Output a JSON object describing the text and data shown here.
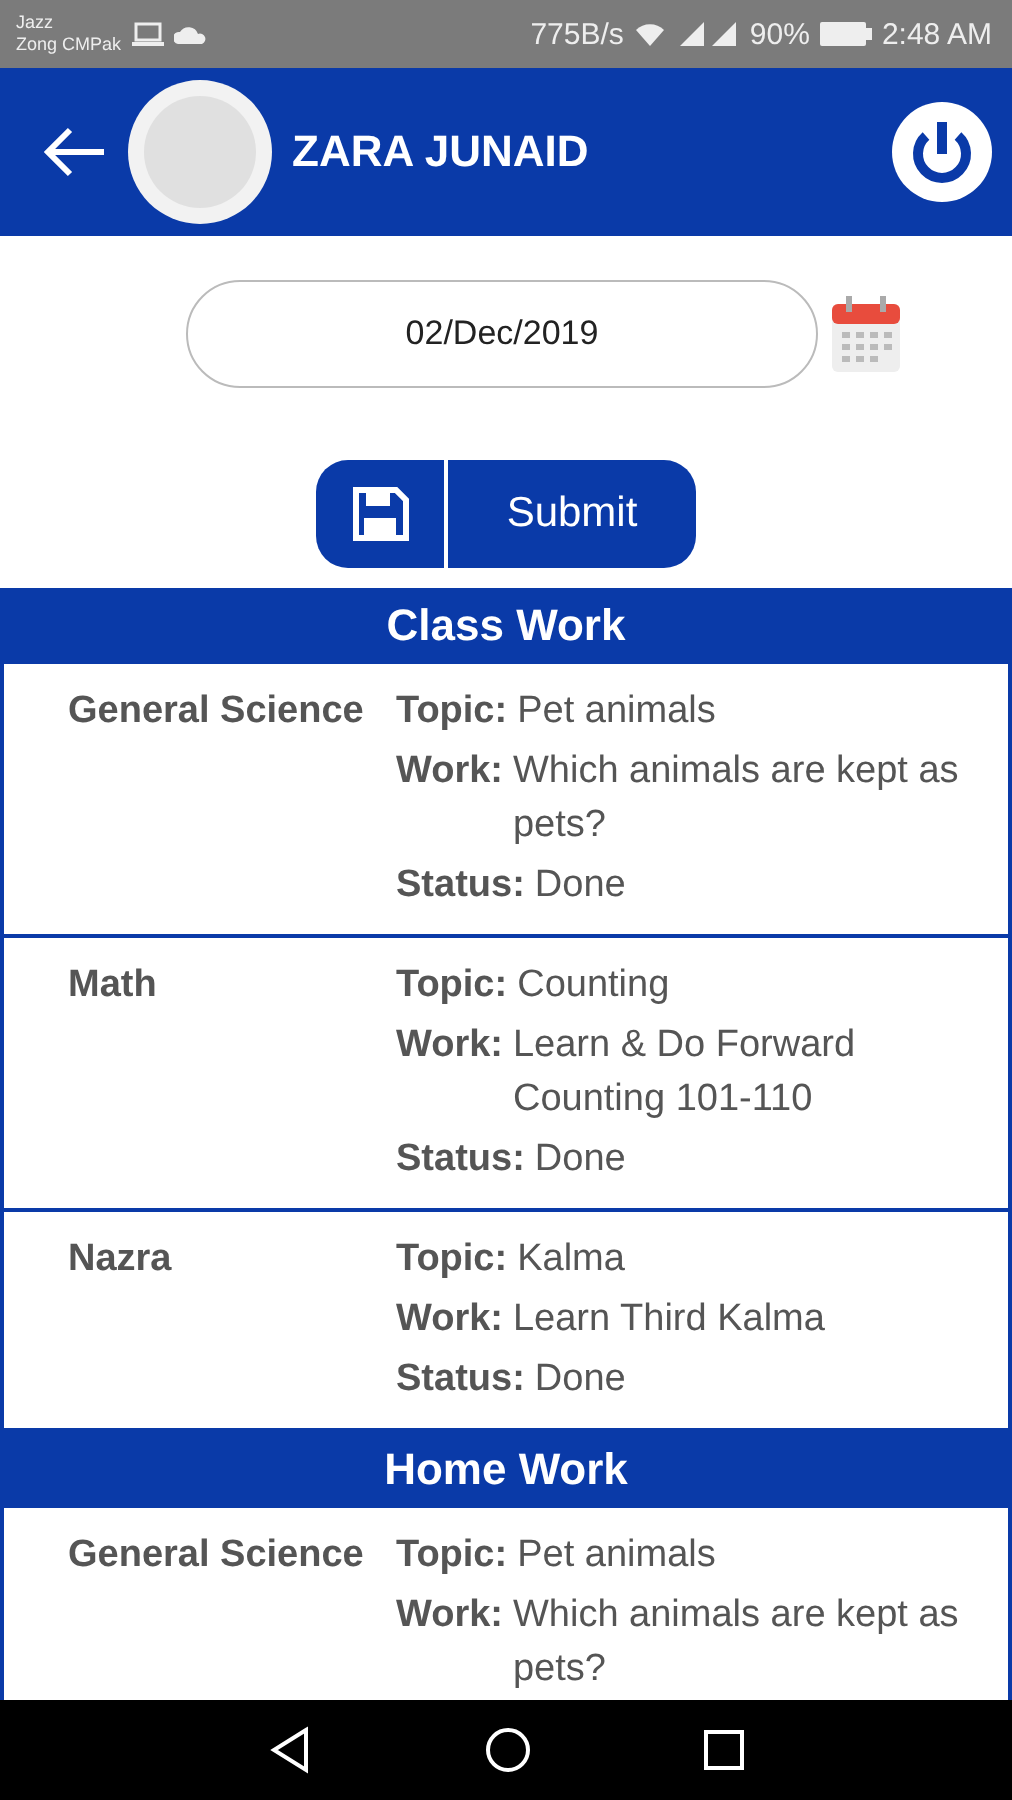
{
  "status_bar": {
    "carriers": [
      "Jazz",
      "Zong CMPak"
    ],
    "speed": "775B/s",
    "battery": "90%",
    "time": "2:48 AM"
  },
  "app_bar": {
    "title": "ZARA JUNAID"
  },
  "date_field": {
    "value": "02/Dec/2019"
  },
  "submit_button": {
    "label": "Submit"
  },
  "sections": [
    {
      "title": "Class Work",
      "entries": [
        {
          "subject": "General Science",
          "fields": [
            {
              "label": "Topic:",
              "value": "Pet animals"
            },
            {
              "label": "Work:",
              "value": "Which animals are kept as pets?"
            },
            {
              "label": "Status:",
              "value": "Done"
            }
          ]
        },
        {
          "subject": "Math",
          "fields": [
            {
              "label": "Topic:",
              "value": "Counting"
            },
            {
              "label": "Work:",
              "value": "Learn & Do Forward Counting 101-110"
            },
            {
              "label": "Status:",
              "value": "Done"
            }
          ]
        },
        {
          "subject": "Nazra",
          "fields": [
            {
              "label": "Topic:",
              "value": "Kalma"
            },
            {
              "label": "Work:",
              "value": "Learn Third Kalma"
            },
            {
              "label": "Status:",
              "value": "Done"
            }
          ]
        }
      ]
    },
    {
      "title": "Home Work",
      "entries": [
        {
          "subject": "General Science",
          "fields": [
            {
              "label": "Topic:",
              "value": "Pet animals"
            },
            {
              "label": "Work:",
              "value": "Which animals are kept as pets?"
            }
          ]
        }
      ]
    }
  ]
}
